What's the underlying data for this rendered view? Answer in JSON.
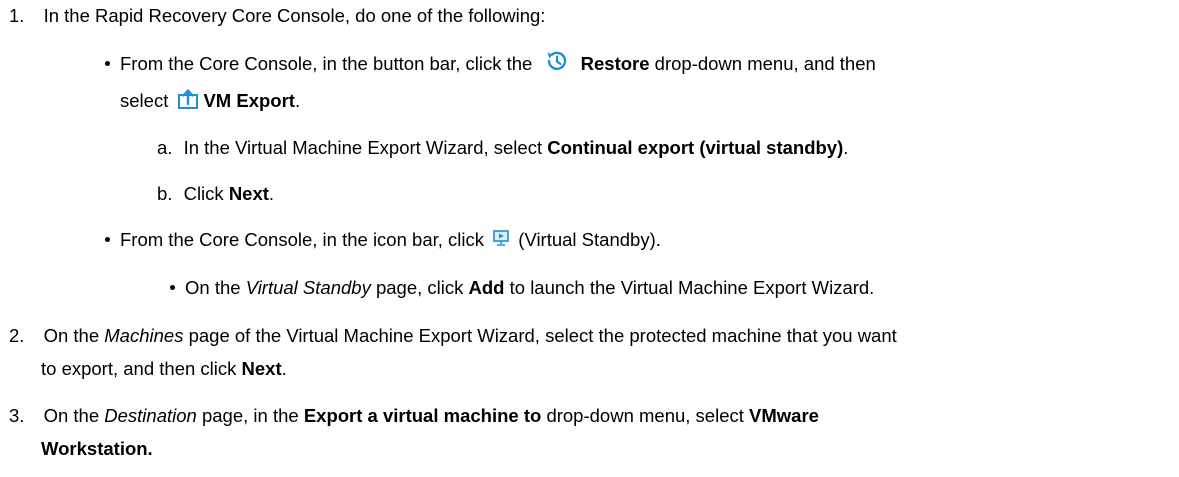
{
  "steps": [
    {
      "number": "1.",
      "text": "In the Rapid Recovery Core Console, do one of the following:",
      "options": [
        {
          "pre": "From the Core Console, in the button bar, click the",
          "restore_label": "Restore",
          "mid": "drop-down menu, and then",
          "select_word": "select",
          "vm_export_label": "VM Export",
          "end": ".",
          "substeps": [
            {
              "letter": "a.",
              "pre": "In the Virtual Machine Export Wizard, select",
              "bold": "Continual export (virtual standby)",
              "post": "."
            },
            {
              "letter": "b.",
              "pre": "Click",
              "bold": "Next",
              "post": "."
            }
          ]
        },
        {
          "pre": "From the Core Console, in the icon bar, click",
          "post": "(Virtual Standby).",
          "subbullet": {
            "pre": "On the",
            "italic": "Virtual Standby",
            "mid": "page, click",
            "bold": "Add",
            "post": "to launch the Virtual Machine Export Wizard."
          }
        }
      ]
    },
    {
      "number": "2.",
      "pre": "On the",
      "italic": "Machines",
      "mid": "page of the Virtual Machine Export Wizard, select the protected machine that you want",
      "line2_pre": "to export, and then click",
      "line2_bold": "Next",
      "line2_post": "."
    },
    {
      "number": "3.",
      "pre": "On the",
      "italic": "Destination",
      "mid": "page, in the",
      "bold1": "Export a virtual machine to",
      "mid2": "drop-down menu, select",
      "bold2": "VMware",
      "line2_bold": "Workstation."
    }
  ],
  "icons": {
    "restore": "restore-history-icon",
    "vm_export": "vm-export-icon",
    "virtual_standby": "virtual-standby-icon"
  },
  "colors": {
    "text": "#000000",
    "icon_blue": "#1e8fd6"
  }
}
